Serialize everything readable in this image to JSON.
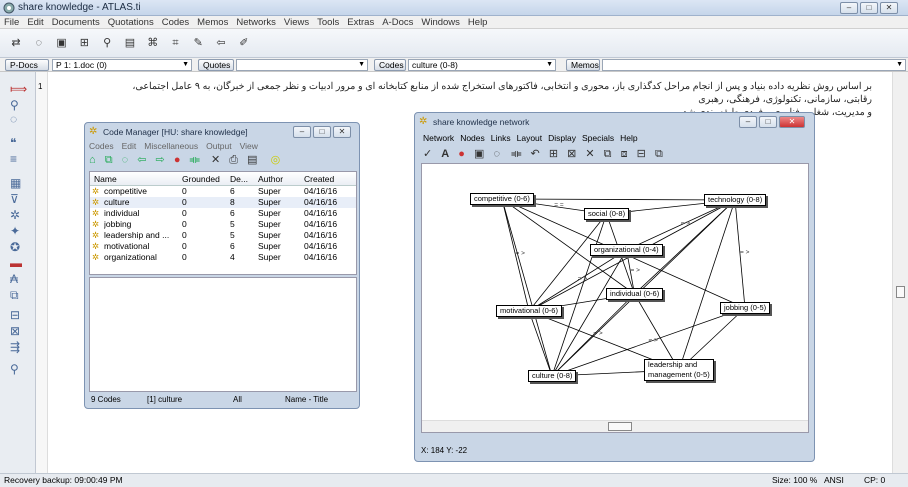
{
  "app": {
    "title": "share knowledge - ATLAS.ti"
  },
  "menu": [
    "File",
    "Edit",
    "Documents",
    "Quotations",
    "Codes",
    "Memos",
    "Networks",
    "Views",
    "Tools",
    "Extras",
    "A-Docs",
    "Windows",
    "Help"
  ],
  "docbar": {
    "pdocs_label": "P-Docs",
    "pdoc_value": "P 1: 1.doc (0)",
    "quotes_label": "Quotes",
    "codes_label": "Codes",
    "codes_value": "culture (0-8)",
    "memos_label": "Memos"
  },
  "document": {
    "line_number": "1",
    "text_line1": "بر اساس روش نظریه داده بنیاد و پس از انجام مراحل کدگذاری باز، محوری و انتخابی، فاکتورهای استخراج شده از منابع کتابخانه ای و مرور ادبیات و نظر جمعی از خبرگان، به ۹ عامل اجتماعی، رقابتی، سازمانی، تکنولوژی، فرهنگی، رهبری",
    "text_line2": "و مدیریت، شغلی، فناوری و فردی طبقه بندی شد."
  },
  "code_manager": {
    "title": "Code Manager [HU: share knowledge]",
    "menu": [
      "Codes",
      "Edit",
      "Miscellaneous",
      "Output",
      "View"
    ],
    "columns": [
      "Name",
      "Grounded",
      "De...",
      "Author",
      "Created"
    ],
    "rows": [
      {
        "name": "competitive",
        "grounded": "0",
        "density": "6",
        "author": "Super",
        "created": "04/16/16"
      },
      {
        "name": "culture",
        "grounded": "0",
        "density": "8",
        "author": "Super",
        "created": "04/16/16"
      },
      {
        "name": "individual",
        "grounded": "0",
        "density": "6",
        "author": "Super",
        "created": "04/16/16"
      },
      {
        "name": "jobbing",
        "grounded": "0",
        "density": "5",
        "author": "Super",
        "created": "04/16/16"
      },
      {
        "name": "leadership and ...",
        "grounded": "0",
        "density": "5",
        "author": "Super",
        "created": "04/16/16"
      },
      {
        "name": "motivational",
        "grounded": "0",
        "density": "6",
        "author": "Super",
        "created": "04/16/16"
      },
      {
        "name": "organizational",
        "grounded": "0",
        "density": "4",
        "author": "Super",
        "created": "04/16/16"
      }
    ],
    "status": {
      "count": "9 Codes",
      "selected": "[1] culture",
      "filter": "All",
      "sort": "Name - Title"
    }
  },
  "network": {
    "title": "share knowledge network",
    "menu": [
      "Network",
      "Nodes",
      "Links",
      "Layout",
      "Display",
      "Specials",
      "Help"
    ],
    "nodes": [
      {
        "id": "competitive",
        "label": "competitive (0-6)"
      },
      {
        "id": "social",
        "label": "social (0-8)"
      },
      {
        "id": "technology",
        "label": "technology (0-8)"
      },
      {
        "id": "organizational",
        "label": "organizational (0-4)"
      },
      {
        "id": "individual",
        "label": "individual (0-6)"
      },
      {
        "id": "motivational",
        "label": "motivational (0-6)"
      },
      {
        "id": "jobbing",
        "label": "jobbing (0-5)"
      },
      {
        "id": "culture",
        "label": "culture (0-8)"
      },
      {
        "id": "leadership",
        "label": "leadership and\nmanagement (0-5)"
      }
    ],
    "edge_label": "= >",
    "edge_label_eq": "= =",
    "coords": "X: 184 Y: -22"
  },
  "status": {
    "left": "Recovery backup: 09:00:49 PM",
    "size": "Size: 100 %",
    "encoding": "ANSI",
    "cp": "CP: 0"
  },
  "colors": {
    "accent": "#c9d6e6",
    "link": "#000000"
  }
}
